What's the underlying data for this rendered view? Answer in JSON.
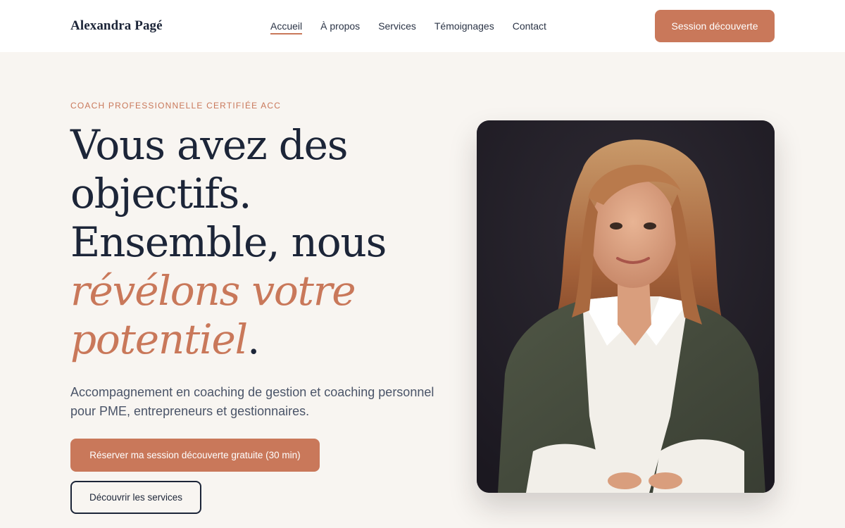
{
  "header": {
    "brand": "Alexandra Pagé",
    "nav": [
      {
        "label": "Accueil",
        "active": true
      },
      {
        "label": "À propos",
        "active": false
      },
      {
        "label": "Services",
        "active": false
      },
      {
        "label": "Témoignages",
        "active": false
      },
      {
        "label": "Contact",
        "active": false
      }
    ],
    "cta_label": "Session découverte"
  },
  "hero": {
    "eyebrow": "COACH PROFESSIONNELLE CERTIFIÉE ACC",
    "headline": {
      "line1": "Vous avez des",
      "line2": "objectifs.",
      "line3": "Ensemble, nous",
      "line4_accent": "révélons votre",
      "line5_accent": "potentiel",
      "line5_end": "."
    },
    "subtitle": "Accompagnement en coaching de gestion et coaching personnel pour PME, entrepreneurs et gestionnaires.",
    "primary_button": "Réserver ma session découverte gratuite (30 min)",
    "secondary_button": "Découvrir les services"
  },
  "colors": {
    "accent": "#c9785a",
    "navy": "#1c2538",
    "background": "#f8f5f1"
  }
}
